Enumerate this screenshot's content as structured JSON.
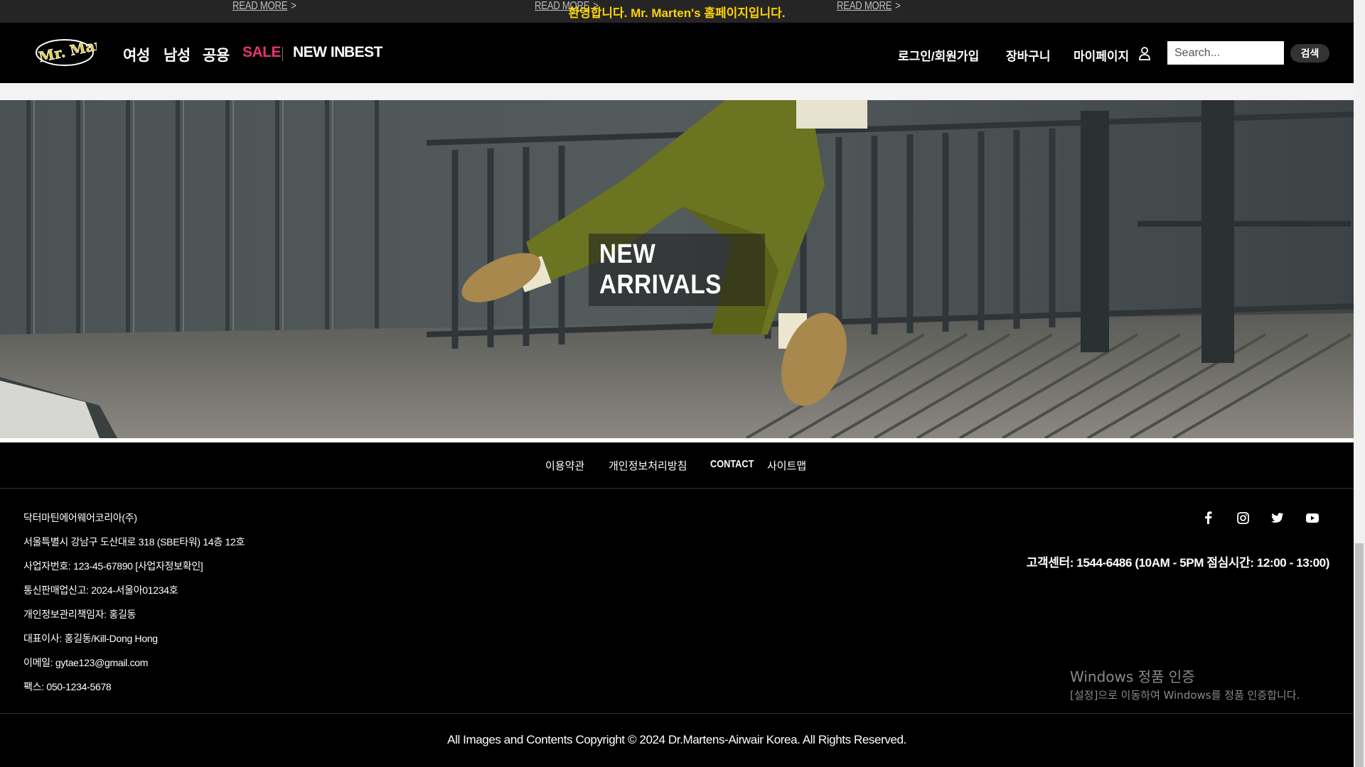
{
  "top_strip": {
    "read_more": [
      "READ MORE",
      "READ MORE",
      "READ MORE"
    ],
    "arrow": ">",
    "welcome": "환영합니다. Mr. Marten's 홈페이지입니다."
  },
  "header": {
    "logo_text": "Mr. Martens",
    "nav": [
      {
        "label": "여성"
      },
      {
        "label": "남성"
      },
      {
        "label": "공용"
      },
      {
        "label": "SALE"
      },
      {
        "label": "NEW IN"
      },
      {
        "label": "BEST"
      }
    ],
    "util": {
      "login": "로그인/회원가입",
      "cart": "장바구니",
      "mypage": "마이페이지"
    },
    "search": {
      "placeholder": "Search...",
      "button": "검색"
    }
  },
  "hero": {
    "title": "NEW ARRIVALS"
  },
  "footer": {
    "links": [
      "이용약관",
      "개인정보처리방침",
      "CONTACT",
      "사이트맵"
    ],
    "info": [
      "닥터마틴에어웨어코리아(주)",
      "서울특별시 강남구 도산대로 318 (SBE타워) 14층 12호",
      "사업자번호: 123-45-67890 [사업자정보확인]",
      "통신판매업신고: 2024-서울아01234호",
      "개인정보관리책임자: 홍길동",
      "대표이사: 홍길동/Kill-Dong Hong",
      "이메일: gytae123@gmail.com",
      "팩스: 050-1234-5678"
    ],
    "social": [
      "facebook-icon",
      "instagram-icon",
      "twitter-icon",
      "youtube-icon"
    ],
    "customer_center": "고객센터: 1544-6486 (10AM - 5PM 점심시간: 12:00 - 13:00)",
    "copyright": "All Images and Contents Copyright © 2024 Dr.Martens-Airwair Korea. All Rights Reserved."
  },
  "watermark": {
    "title": "Windows 정품 인증",
    "subtitle": "[설정]으로 이동하여 Windows를 정품 인증합니다."
  },
  "colors": {
    "accent_sale": "#e8356b",
    "welcome": "#ffd400"
  }
}
